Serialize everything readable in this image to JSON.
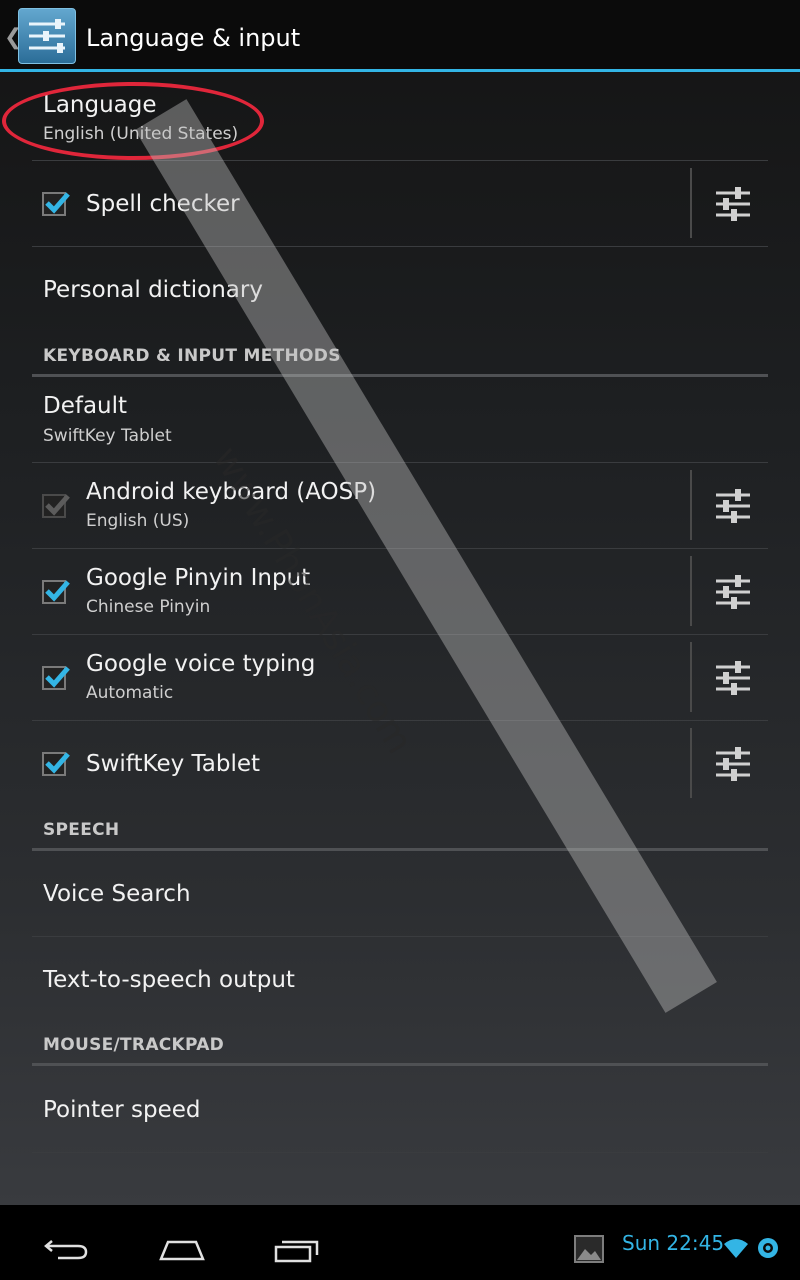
{
  "action_bar": {
    "title": "Language & input"
  },
  "annotation": {
    "watermark": "www.PhonAsia.com"
  },
  "rows": {
    "language": {
      "title": "Language",
      "summary": "English (United States)"
    },
    "spell_checker": {
      "title": "Spell checker",
      "checked": true
    },
    "personal_dictionary": {
      "title": "Personal dictionary"
    },
    "default": {
      "title": "Default",
      "summary": "SwiftKey Tablet"
    },
    "android_keyboard": {
      "title": "Android keyboard (AOSP)",
      "summary": "English (US)",
      "checked": true,
      "enabled": false
    },
    "google_pinyin": {
      "title": "Google Pinyin Input",
      "summary": "Chinese Pinyin",
      "checked": true
    },
    "google_voice": {
      "title": "Google voice typing",
      "summary": "Automatic",
      "checked": true
    },
    "swiftkey": {
      "title": "SwiftKey Tablet",
      "checked": true
    },
    "voice_search": {
      "title": "Voice Search"
    },
    "tts": {
      "title": "Text-to-speech output"
    },
    "pointer_speed": {
      "title": "Pointer speed"
    }
  },
  "sections": {
    "keyboard": "KEYBOARD & INPUT METHODS",
    "speech": "SPEECH",
    "mouse": "MOUSE/TRACKPAD"
  },
  "status_bar": {
    "clock": "Sun 22:45"
  },
  "icons": {
    "back": "back-icon",
    "home": "home-icon",
    "recents": "recent-apps-icon",
    "settings": "settings-sliders-icon",
    "screenshot": "screenshot-icon",
    "wifi": "wifi-icon",
    "sync": "sync-icon"
  },
  "colors": {
    "accent": "#33b5e5",
    "annotation_red": "#e0263a"
  }
}
